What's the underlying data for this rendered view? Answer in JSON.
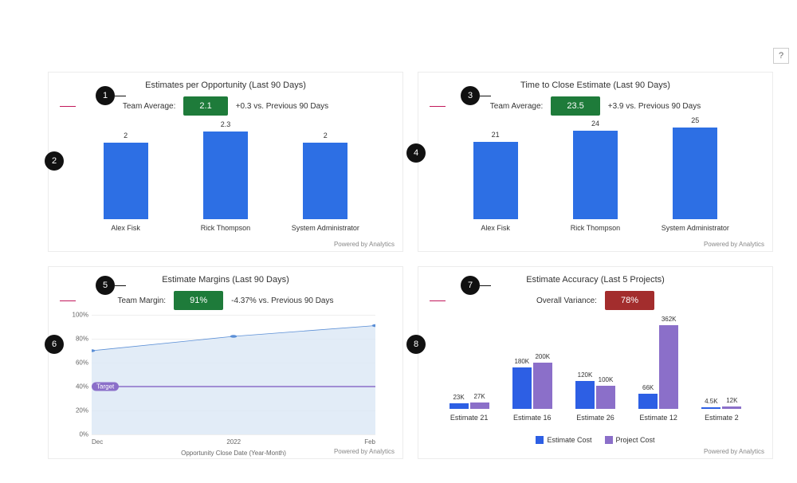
{
  "help": "?",
  "footer": "Powered by Analytics",
  "callouts": [
    "1",
    "2",
    "3",
    "4",
    "5",
    "6",
    "7",
    "8"
  ],
  "cards": {
    "c1": {
      "title": "Estimates per Opportunity (Last 90 Days)",
      "metric_label": "Team Average:",
      "metric_value": "2.1",
      "metric_delta": "+0.3 vs. Previous 90 Days"
    },
    "c2": {
      "title": "Time to Close Estimate (Last 90 Days)",
      "metric_label": "Team Average:",
      "metric_value": "23.5",
      "metric_delta": "+3.9 vs. Previous 90 Days"
    },
    "c3": {
      "title": "Estimate Margins (Last 90 Days)",
      "metric_label": "Team Margin:",
      "metric_value": "91%",
      "metric_delta": "-4.37% vs. Previous 90 Days",
      "target_label": "Target",
      "x_axis_label": "Opportunity Close Date (Year-Month)"
    },
    "c4": {
      "title": "Estimate Accuracy (Last 5 Projects)",
      "metric_label": "Overall Variance:",
      "metric_value": "78%",
      "legend_a": "Estimate Cost",
      "legend_b": "Project Cost"
    }
  },
  "chart_data": [
    {
      "id": "c1",
      "type": "bar",
      "title": "Estimates per Opportunity (Last 90 Days)",
      "categories": [
        "Alex Fisk",
        "Rick Thompson",
        "System Administrator"
      ],
      "values": [
        2,
        2.3,
        2
      ],
      "ylim": [
        0,
        2.5
      ]
    },
    {
      "id": "c2",
      "type": "bar",
      "title": "Time to Close Estimate (Last 90 Days)",
      "categories": [
        "Alex Fisk",
        "Rick Thompson",
        "System Administrator"
      ],
      "values": [
        21,
        24,
        25
      ],
      "ylim": [
        0,
        26
      ]
    },
    {
      "id": "c3",
      "type": "area",
      "title": "Estimate Margins (Last 90 Days)",
      "x": [
        "Dec",
        "2022",
        "Feb"
      ],
      "values": [
        70,
        82,
        91
      ],
      "target": 40,
      "ylim": [
        0,
        100
      ],
      "yticks_pct": [
        0,
        20,
        40,
        60,
        80,
        100
      ],
      "xlabel": "Opportunity Close Date (Year-Month)",
      "ylabel": ""
    },
    {
      "id": "c4",
      "type": "bar",
      "title": "Estimate Accuracy (Last 5 Projects)",
      "categories": [
        "Estimate 21",
        "Estimate 16",
        "Estimate 26",
        "Estimate 12",
        "Estimate 2"
      ],
      "series": [
        {
          "name": "Estimate Cost",
          "values_label": [
            "23K",
            "180K",
            "120K",
            "66K",
            "4.5K"
          ],
          "values": [
            23,
            180,
            120,
            66,
            4.5
          ]
        },
        {
          "name": "Project Cost",
          "values_label": [
            "27K",
            "200K",
            "100K",
            "362K",
            "12K"
          ],
          "values": [
            27,
            200,
            100,
            362,
            12
          ]
        }
      ],
      "ylim": [
        0,
        380
      ]
    }
  ]
}
